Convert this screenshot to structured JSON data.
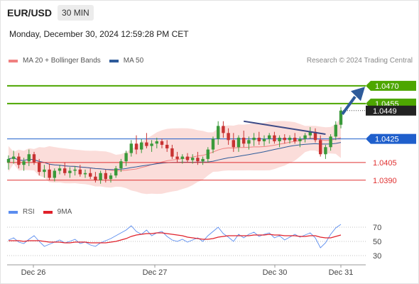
{
  "header": {
    "pair": "EUR/USD",
    "timeframe": "30 MIN",
    "datetime": "Monday, December 30, 2024 12:59:28 PM CET",
    "credit": "Research © 2024 Trading Central"
  },
  "legend": {
    "ma20": "MA 20 + Bollinger Bands",
    "ma50": "MA 50",
    "ma20_color": "#f08080",
    "ma50_color": "#2e5b9a"
  },
  "rsi_legend": {
    "rsi": "RSI",
    "ma": "9MA",
    "rsi_color": "#5b8def",
    "ma_color": "#e0202a"
  },
  "chart_data": [
    {
      "type": "candlestick",
      "title": "EUR/USD 30 MIN",
      "ylim": [
        1.0373,
        1.0485
      ],
      "x_ticks": [
        "Dec 26",
        "Dec 27",
        "Dec 30",
        "Dec 31"
      ],
      "price_levels": [
        {
          "label": "1.0470",
          "value": 1.047,
          "kind": "resistance",
          "color": "#4da600"
        },
        {
          "label": "1.0455",
          "value": 1.0455,
          "kind": "resistance",
          "color": "#4da600"
        },
        {
          "label": "1.0449",
          "value": 1.0449,
          "kind": "last",
          "color": "#222222"
        },
        {
          "label": "1.0425",
          "value": 1.0425,
          "kind": "pivot",
          "color": "#1f5fcc"
        },
        {
          "label": "1.0405",
          "value": 1.0405,
          "kind": "support",
          "color": "#e03030"
        },
        {
          "label": "1.0390",
          "value": 1.039,
          "kind": "support",
          "color": "#e03030"
        }
      ],
      "trendline": [
        [
          0.7,
          1.0438
        ],
        [
          1.98,
          1.0428
        ]
      ],
      "projection_arrow": {
        "from": 1.0446,
        "to": 1.0468
      },
      "candles": [
        [
          1.0405,
          1.0411,
          1.0399,
          1.0408
        ],
        [
          1.0408,
          1.0415,
          1.0404,
          1.041
        ],
        [
          1.041,
          1.0413,
          1.04,
          1.0403
        ],
        [
          1.0403,
          1.0409,
          1.0398,
          1.0406
        ],
        [
          1.0406,
          1.0416,
          1.0402,
          1.0412
        ],
        [
          1.0412,
          1.0414,
          1.0403,
          1.0405
        ],
        [
          1.0405,
          1.0408,
          1.0394,
          1.0397
        ],
        [
          1.0397,
          1.0403,
          1.0392,
          1.0399
        ],
        [
          1.0399,
          1.0404,
          1.039,
          1.0392
        ],
        [
          1.0392,
          1.04,
          1.0389,
          1.0398
        ],
        [
          1.0398,
          1.0403,
          1.0395,
          1.04
        ],
        [
          1.04,
          1.0405,
          1.0394,
          1.0396
        ],
        [
          1.0396,
          1.0401,
          1.0392,
          1.0398
        ],
        [
          1.0398,
          1.0402,
          1.0394,
          1.0399
        ],
        [
          1.0399,
          1.0403,
          1.0393,
          1.0395
        ],
        [
          1.0395,
          1.0399,
          1.0392,
          1.0396
        ],
        [
          1.0396,
          1.04,
          1.0391,
          1.0393
        ],
        [
          1.0393,
          1.0397,
          1.0388,
          1.039
        ],
        [
          1.039,
          1.0398,
          1.0387,
          1.0396
        ],
        [
          1.0396,
          1.0399,
          1.0388,
          1.0391
        ],
        [
          1.0391,
          1.0396,
          1.0388,
          1.0394
        ],
        [
          1.0394,
          1.0402,
          1.0392,
          1.04
        ],
        [
          1.04,
          1.0408,
          1.0397,
          1.0406
        ],
        [
          1.0406,
          1.0415,
          1.0402,
          1.0413
        ],
        [
          1.0413,
          1.0424,
          1.041,
          1.0421
        ],
        [
          1.0421,
          1.0428,
          1.0412,
          1.0416
        ],
        [
          1.0416,
          1.0425,
          1.0413,
          1.0422
        ],
        [
          1.0422,
          1.043,
          1.0417,
          1.0419
        ],
        [
          1.0419,
          1.0424,
          1.0414,
          1.0421
        ],
        [
          1.0421,
          1.0426,
          1.0417,
          1.0423
        ],
        [
          1.0423,
          1.0425,
          1.0417,
          1.042
        ],
        [
          1.042,
          1.0424,
          1.0414,
          1.0417
        ],
        [
          1.0417,
          1.042,
          1.0408,
          1.041
        ],
        [
          1.041,
          1.0414,
          1.0405,
          1.0408
        ],
        [
          1.0408,
          1.0412,
          1.0404,
          1.041
        ],
        [
          1.041,
          1.0413,
          1.0405,
          1.0407
        ],
        [
          1.0407,
          1.0412,
          1.0404,
          1.0409
        ],
        [
          1.0409,
          1.0414,
          1.0403,
          1.0406
        ],
        [
          1.0406,
          1.041,
          1.0403,
          1.0408
        ],
        [
          1.0408,
          1.0418,
          1.0405,
          1.0416
        ],
        [
          1.0416,
          1.0427,
          1.0413,
          1.0425
        ],
        [
          1.0425,
          1.044,
          1.042,
          1.0436
        ],
        [
          1.0436,
          1.044,
          1.0426,
          1.043
        ],
        [
          1.043,
          1.0434,
          1.042,
          1.0424
        ],
        [
          1.0424,
          1.043,
          1.0414,
          1.0418
        ],
        [
          1.0418,
          1.0428,
          1.0414,
          1.0426
        ],
        [
          1.0426,
          1.0432,
          1.0418,
          1.0421
        ],
        [
          1.0421,
          1.0427,
          1.0416,
          1.0424
        ],
        [
          1.0424,
          1.043,
          1.0419,
          1.0426
        ],
        [
          1.0426,
          1.0431,
          1.042,
          1.0423
        ],
        [
          1.0423,
          1.0428,
          1.0419,
          1.0425
        ],
        [
          1.0425,
          1.043,
          1.0421,
          1.0428
        ],
        [
          1.0428,
          1.0431,
          1.0421,
          1.0423
        ],
        [
          1.0423,
          1.0428,
          1.0418,
          1.0426
        ],
        [
          1.0426,
          1.0429,
          1.0421,
          1.0424
        ],
        [
          1.0424,
          1.0428,
          1.0421,
          1.0426
        ],
        [
          1.0426,
          1.043,
          1.0421,
          1.0423
        ],
        [
          1.0423,
          1.0427,
          1.0418,
          1.0425
        ],
        [
          1.0425,
          1.043,
          1.0422,
          1.0428
        ],
        [
          1.0428,
          1.0435,
          1.0425,
          1.0431
        ],
        [
          1.0431,
          1.0434,
          1.0422,
          1.0424
        ],
        [
          1.0424,
          1.0428,
          1.041,
          1.0412
        ],
        [
          1.0412,
          1.042,
          1.0408,
          1.0418
        ],
        [
          1.0418,
          1.0429,
          1.0415,
          1.0427
        ],
        [
          1.0427,
          1.044,
          1.0424,
          1.0437
        ],
        [
          1.0437,
          1.0452,
          1.0434,
          1.0449
        ]
      ]
    },
    {
      "type": "line",
      "title": "RSI",
      "ylim": [
        20,
        80
      ],
      "y_ticks": [
        70,
        50,
        30
      ],
      "series": [
        {
          "name": "RSI",
          "values": [
            52,
            55,
            49,
            47,
            53,
            58,
            50,
            43,
            46,
            49,
            52,
            48,
            50,
            53,
            47,
            49,
            45,
            43,
            48,
            51,
            54,
            58,
            62,
            66,
            72,
            64,
            60,
            66,
            58,
            62,
            64,
            57,
            52,
            50,
            53,
            49,
            52,
            55,
            50,
            58,
            64,
            70,
            61,
            56,
            50,
            60,
            55,
            60,
            63,
            57,
            60,
            62,
            55,
            58,
            52,
            56,
            60,
            56,
            59,
            62,
            55,
            41,
            48,
            60,
            69,
            74
          ]
        },
        {
          "name": "9MA",
          "values": [
            51,
            51,
            51,
            50,
            51,
            51,
            51,
            50,
            49,
            49,
            49,
            48,
            48,
            49,
            49,
            49,
            48,
            48,
            48,
            48,
            49,
            50,
            52,
            54,
            57,
            59,
            60,
            61,
            61,
            62,
            62,
            61,
            60,
            59,
            58,
            56,
            55,
            54,
            53,
            53,
            54,
            56,
            57,
            58,
            58,
            58,
            58,
            58,
            59,
            59,
            59,
            60,
            59,
            59,
            58,
            58,
            58,
            57,
            57,
            58,
            58,
            56,
            55,
            55,
            57,
            59
          ]
        }
      ]
    }
  ]
}
